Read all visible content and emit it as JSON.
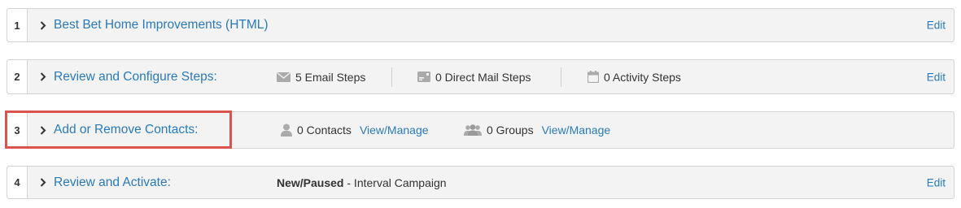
{
  "steps": [
    {
      "number": "1",
      "title": "Best Bet Home Improvements (HTML)",
      "edit_label": "Edit"
    },
    {
      "number": "2",
      "title": "Review and Configure Steps:",
      "email_steps": "5 Email Steps",
      "direct_mail_steps": "0 Direct Mail Steps",
      "activity_steps": "0 Activity Steps",
      "edit_label": "Edit"
    },
    {
      "number": "3",
      "title": "Add or Remove Contacts:",
      "contacts": "0 Contacts",
      "contacts_link": "View/Manage",
      "groups": "0 Groups",
      "groups_link": "View/Manage"
    },
    {
      "number": "4",
      "title": "Review and Activate:",
      "status_bold": "New/Paused",
      "status_rest": " - Interval Campaign",
      "edit_label": "Edit"
    }
  ],
  "colors": {
    "link": "#2a7ab9",
    "highlight": "#d9534f",
    "panel_bg": "#f3f3f3",
    "icon": "#aaaaaa"
  },
  "icons": [
    "chevron-right-icon",
    "envelope-icon",
    "mail-card-icon",
    "calendar-icon",
    "person-icon",
    "group-icon"
  ]
}
